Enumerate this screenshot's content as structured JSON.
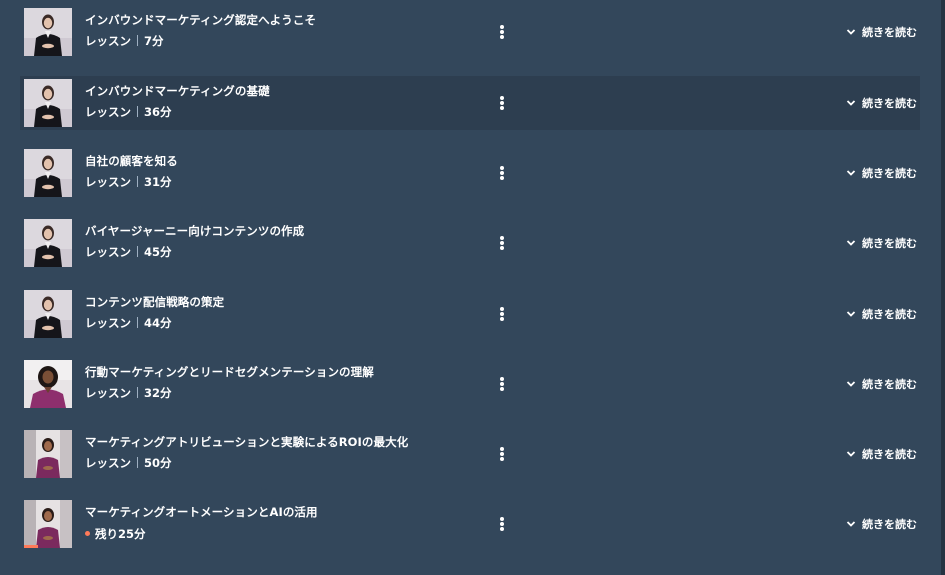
{
  "colors": {
    "background": "#33475b",
    "hover_row": "#2d3e50",
    "accent": "#ff7a59"
  },
  "lessons": [
    {
      "title": "インバウンドマーケティング認定へようこそ",
      "type": "レッスン",
      "duration": "7分",
      "expand_label": "続きを読む",
      "instructor": "presenter-a"
    },
    {
      "title": "インバウンドマーケティングの基礎",
      "type": "レッスン",
      "duration": "36分",
      "expand_label": "続きを読む",
      "instructor": "presenter-a"
    },
    {
      "title": "自社の顧客を知る",
      "type": "レッスン",
      "duration": "31分",
      "expand_label": "続きを読む",
      "instructor": "presenter-a"
    },
    {
      "title": "バイヤージャーニー向けコンテンツの作成",
      "type": "レッスン",
      "duration": "45分",
      "expand_label": "続きを読む",
      "instructor": "presenter-a"
    },
    {
      "title": "コンテンツ配信戦略の策定",
      "type": "レッスン",
      "duration": "44分",
      "expand_label": "続きを読む",
      "instructor": "presenter-a"
    },
    {
      "title": "行動マーケティングとリードセグメンテーションの理解",
      "type": "レッスン",
      "duration": "32分",
      "expand_label": "続きを読む",
      "instructor": "presenter-b"
    },
    {
      "title": "マーケティングアトリビューションと実験によるROIの最大化",
      "type": "レッスン",
      "duration": "50分",
      "expand_label": "続きを読む",
      "instructor": "presenter-c"
    },
    {
      "title": "マーケティングオートメーションとAIの活用",
      "remaining": "残り25分",
      "progress": 0.3,
      "expand_label": "続きを読む",
      "instructor": "presenter-c"
    }
  ]
}
